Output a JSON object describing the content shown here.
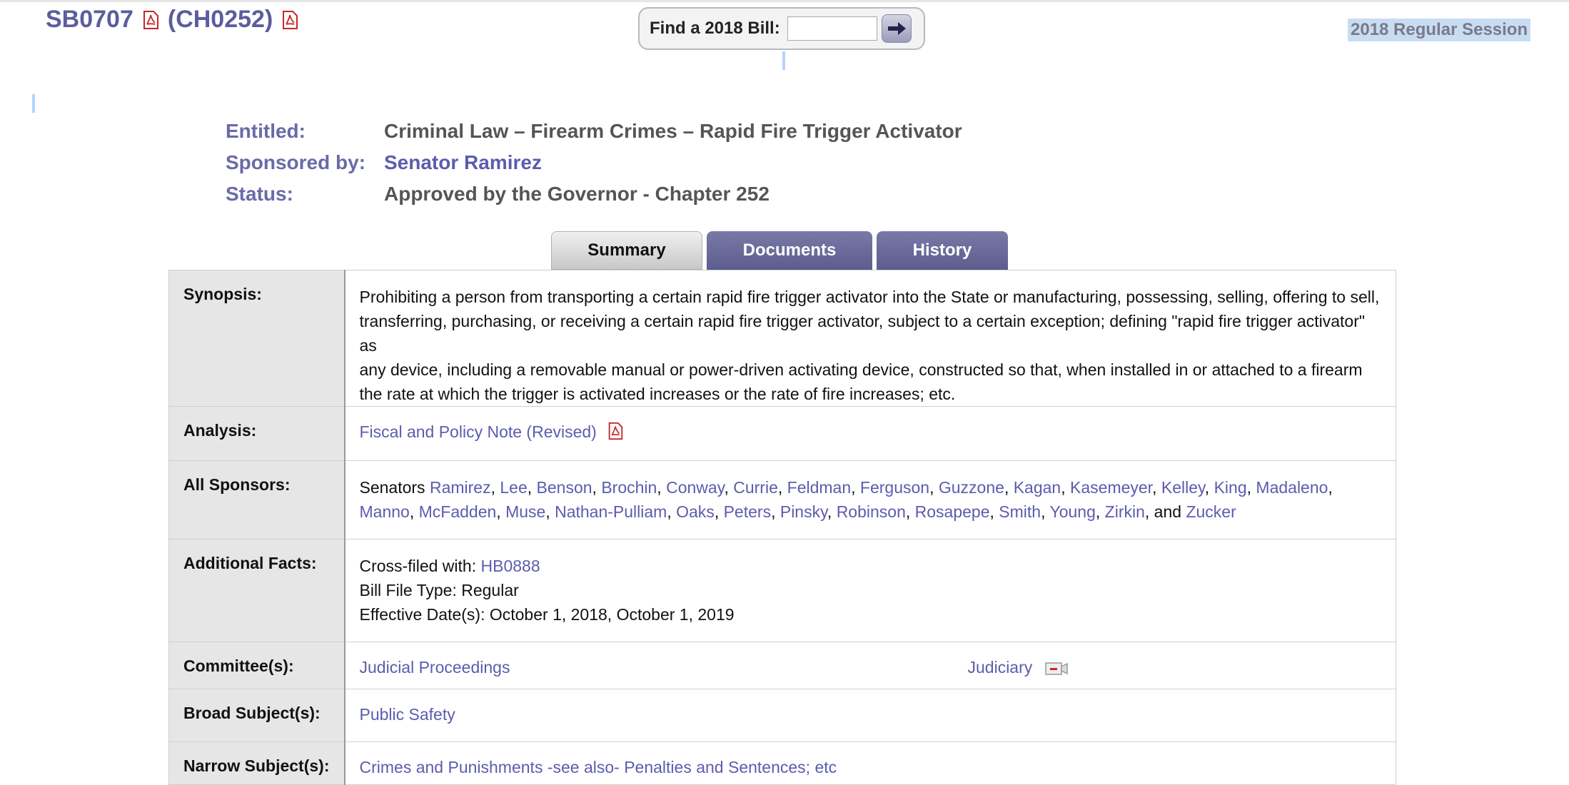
{
  "header": {
    "bill_number": "SB0707",
    "chapter": "(CH0252)",
    "session": "2018 Regular Session"
  },
  "finder": {
    "label": "Find a 2018 Bill:",
    "input_value": "",
    "go_icon": "arrow-right-icon"
  },
  "meta": {
    "entitled_label": "Entitled:",
    "entitled_value": "Criminal Law – Firearm Crimes – Rapid Fire Trigger Activator",
    "sponsored_label": "Sponsored by:",
    "sponsored_value": "Senator Ramirez",
    "status_label": "Status:",
    "status_value": "Approved by the Governor - Chapter 252"
  },
  "tabs": {
    "summary": "Summary",
    "documents": "Documents",
    "history": "History"
  },
  "synopsis": {
    "label": "Synopsis:",
    "line1": "Prohibiting a person from transporting a certain rapid fire trigger activator into the State or manufacturing, possessing, selling, offering to sell,",
    "line2": "transferring, purchasing, or receiving a certain rapid fire trigger activator, subject to a certain exception; defining \"rapid fire trigger activator\" as",
    "line3": "any device, including a removable manual or power-driven activating device, constructed so that, when installed in or attached to a firearm",
    "line4": "the rate at which the trigger is activated increases or the rate of fire increases; etc."
  },
  "analysis": {
    "label": "Analysis:",
    "link": "Fiscal and Policy Note (Revised)"
  },
  "sponsors": {
    "label": "All Sponsors:",
    "prefix": "Senators",
    "line1": [
      "Ramirez",
      "Lee",
      "Benson",
      "Brochin",
      "Conway",
      "Currie",
      "Feldman",
      "Ferguson",
      "Guzzone",
      "Kagan",
      "Kasemeyer",
      "Kelley",
      "King",
      "Madaleno"
    ],
    "line2": [
      "Manno",
      "McFadden",
      "Muse",
      "Nathan-Pulliam",
      "Oaks",
      "Peters",
      "Pinsky",
      "Robinson",
      "Rosapepe",
      "Smith",
      "Young",
      "Zirkin"
    ],
    "and_text": "and",
    "last": "Zucker"
  },
  "facts": {
    "label": "Additional Facts:",
    "crossfiled_label": "Cross-filed with:",
    "crossfiled_value": "HB0888",
    "filetype": "Bill File Type: Regular",
    "effective": "Effective Date(s): October 1, 2018, October 1, 2019"
  },
  "committees": {
    "label": "Committee(s):",
    "senate": "Judicial Proceedings",
    "house": "Judiciary"
  },
  "broad": {
    "label": "Broad Subject(s):",
    "value": "Public Safety"
  },
  "narrow": {
    "label": "Narrow Subject(s):",
    "value": "Crimes and Punishments -see also- Penalties and Sentences; etc"
  },
  "colors": {
    "accent": "#5c5cae",
    "tab": "#5c5c8e",
    "label_bg": "#e6e6e6"
  }
}
